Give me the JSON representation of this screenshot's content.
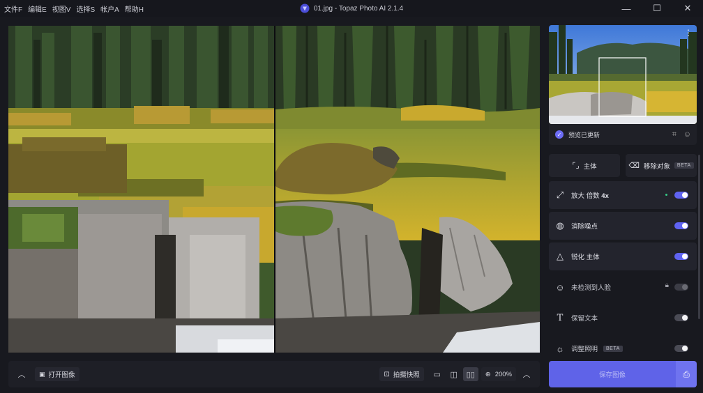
{
  "window": {
    "title": "01.jpg - Topaz Photo AI 2.1.4",
    "menu": [
      "文件F",
      "编辑E",
      "视图V",
      "选择S",
      "帐户A",
      "帮助H"
    ],
    "controls": [
      "minimize-icon",
      "maximize-icon",
      "close-icon"
    ]
  },
  "viewer": {
    "left_label": "original-low-res",
    "right_label": "enhanced-preview"
  },
  "bottombar": {
    "open_image": "打开图像",
    "snapshot": "拍摄快照",
    "zoom": "200%",
    "view_modes": [
      "single-view-icon",
      "split-view-icon",
      "side-by-side-view-icon"
    ],
    "active_view_mode": "side-by-side-view-icon"
  },
  "side": {
    "preview_status": "预览已更新",
    "subject_button": "主体",
    "remove_object_button": "移除对象",
    "beta": "BETA",
    "rows": [
      {
        "label_prefix": "放大 倍数 ",
        "label_strong": "4x",
        "enabled": true,
        "icon": "upscale-icon"
      },
      {
        "label": "消除噪点",
        "enabled": true,
        "icon": "denoise-icon"
      },
      {
        "label": "锐化 主体",
        "enabled": true,
        "icon": "sharpen-icon"
      },
      {
        "label": "未检测到人脸",
        "enabled": false,
        "icon": "face-icon",
        "locked": true
      },
      {
        "label": "保留文本",
        "enabled": false,
        "icon": "text-icon"
      },
      {
        "label": "调整照明",
        "enabled": false,
        "icon": "lighting-icon",
        "beta": true
      }
    ],
    "save_button": "保存图像"
  },
  "colors": {
    "accent": "#5f63f2",
    "background": "#18191f",
    "panel": "#23242d"
  }
}
